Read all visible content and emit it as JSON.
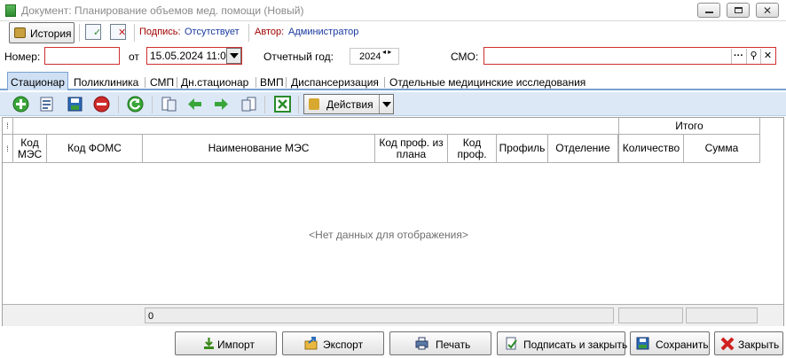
{
  "window": {
    "title": "Документ: Планирование объемов мед. помощи (Новый)"
  },
  "toolbar": {
    "history_label": "История",
    "signature_label": "Подпись:",
    "signature_value": "Отсутствует",
    "author_label": "Автор:",
    "author_value": "Администратор"
  },
  "form": {
    "number_label": "Номер:",
    "number_value": "",
    "from_label": "от",
    "date_value": "15.05.2024 11:0",
    "year_label": "Отчетный год:",
    "year_value": "2024",
    "smo_label": "СМО:",
    "smo_value": "",
    "smo_more_button": "···"
  },
  "tabs": [
    {
      "label": "Стационар",
      "active": true
    },
    {
      "label": "Поликлиника",
      "active": false
    },
    {
      "label": "СМП",
      "active": false
    },
    {
      "label": "Дн.стационар",
      "active": false
    },
    {
      "label": "ВМП",
      "active": false
    },
    {
      "label": "Диспансеризация",
      "active": false
    },
    {
      "label": "Отдельные медицинские исследования",
      "active": false
    }
  ],
  "grid_toolbar": {
    "actions_label": "Действия"
  },
  "grid": {
    "group_header": "Итого",
    "columns": [
      "Код МЭС",
      "Код ФОМС",
      "Наименование МЭС",
      "Код проф. из плана",
      "Код проф.",
      "Профиль",
      "Отделение",
      "Количество",
      "Сумма"
    ],
    "empty_text": "<Нет данных для отображения>",
    "footer_count": "0",
    "footer_quantity": "",
    "footer_sum": ""
  },
  "buttons": {
    "import": "Импорт",
    "export": "Экспорт",
    "print": "Печать",
    "sign_close": "Подписать и закрыть",
    "save": "Сохранить",
    "close": "Закрыть"
  },
  "colors": {
    "tab_active_bg": "#cfe0f4",
    "toolbar_bg": "#dce8f6",
    "required_border": "#d03030",
    "signature_label": "#a00000",
    "signature_value": "#1a3aa0"
  }
}
